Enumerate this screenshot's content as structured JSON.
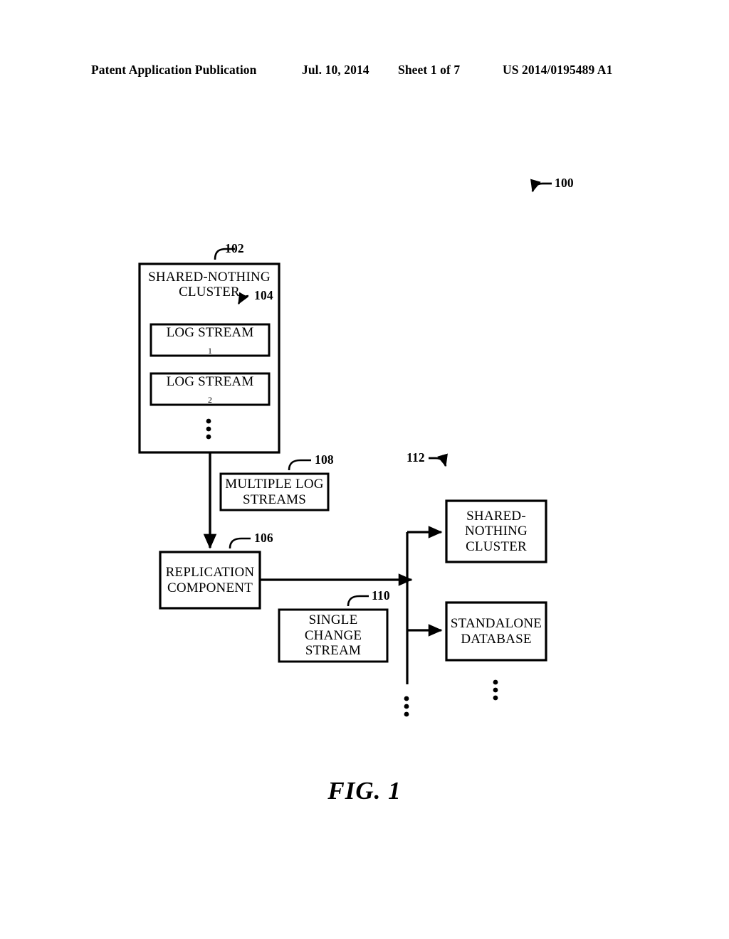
{
  "header": {
    "publication": "Patent Application Publication",
    "date": "Jul. 10, 2014",
    "sheet": "Sheet 1 of 7",
    "patent_number": "US 2014/0195489 A1"
  },
  "figure": {
    "caption": "FIG. 1",
    "overall_ref": "100",
    "boxes": {
      "source_cluster": {
        "ref": "102",
        "line1": "SHARED-NOTHING",
        "line2": "CLUSTER"
      },
      "log_stream_1": {
        "ref": "104",
        "text": "LOG STREAM",
        "subscript": "1"
      },
      "log_stream_2": {
        "text": "LOG STREAM",
        "subscript": "2"
      },
      "multiple_log_streams": {
        "ref": "108",
        "line1": "MULTIPLE LOG",
        "line2": "STREAMS"
      },
      "replication_component": {
        "ref": "106",
        "line1": "REPLICATION",
        "line2": "COMPONENT"
      },
      "single_change_stream": {
        "ref": "110",
        "line1": "SINGLE",
        "line2": "CHANGE",
        "line3": "STREAM"
      },
      "target_group": {
        "ref": "112"
      },
      "target_cluster": {
        "line1": "SHARED-",
        "line2": "NOTHING",
        "line3": "CLUSTER"
      },
      "standalone_database": {
        "line1": "STANDALONE",
        "line2": "DATABASE"
      }
    },
    "colors": {
      "ink": "#000000",
      "paper": "#ffffff"
    }
  }
}
